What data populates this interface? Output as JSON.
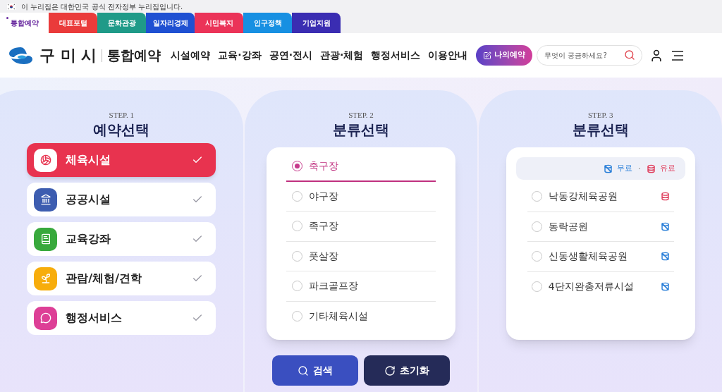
{
  "gov_banner": {
    "text": "이 누리집은 대한민국 공식 전자정부 누리집입니다."
  },
  "site_tabs": [
    {
      "label": "통합예약",
      "selected": true,
      "color": "#6a2ca0"
    },
    {
      "label": "대표포털",
      "selected": false,
      "color": "#ea3b3b"
    },
    {
      "label": "문화관광",
      "selected": false,
      "color": "#1f9a88"
    },
    {
      "label": "일자리경제",
      "selected": false,
      "color": "#1f50d2"
    },
    {
      "label": "시민복지",
      "selected": false,
      "color": "#eb3358"
    },
    {
      "label": "인구정책",
      "selected": false,
      "color": "#1790e2"
    },
    {
      "label": "기업지원",
      "selected": false,
      "color": "#3a2db2"
    }
  ],
  "header": {
    "logo_text": "구 미 시",
    "logo_subtitle": "통합예약",
    "nav": [
      "시설예약",
      "교육·강좌",
      "공연·전시",
      "관광·체험",
      "행정서비스",
      "이용안내"
    ],
    "my_reservation": "나의예약",
    "search_placeholder": "무엇이 궁금하세요?"
  },
  "steps": [
    {
      "kind": "category",
      "step_label": "STEP. 1",
      "title": "예약선택",
      "items": [
        {
          "label": "체육시설",
          "selected": true,
          "color": "#e8334f"
        },
        {
          "label": "공공시설",
          "selected": false,
          "color": "#3d5db0"
        },
        {
          "label": "교육강좌",
          "selected": false,
          "color": "#38a93c"
        },
        {
          "label": "관람/체험/견학",
          "selected": false,
          "color": "#f7ad0c"
        },
        {
          "label": "행정서비스",
          "selected": false,
          "color": "#dd3f96"
        }
      ]
    },
    {
      "kind": "radio",
      "step_label": "STEP. 2",
      "title": "분류선택",
      "items": [
        {
          "label": "축구장",
          "selected": true
        },
        {
          "label": "야구장",
          "selected": false
        },
        {
          "label": "족구장",
          "selected": false
        },
        {
          "label": "풋살장",
          "selected": false
        },
        {
          "label": "파크골프장",
          "selected": false
        },
        {
          "label": "기타체육시설",
          "selected": false
        }
      ]
    },
    {
      "kind": "facility",
      "step_label": "STEP. 3",
      "title": "분류선택",
      "legend": [
        {
          "kind": "free",
          "label": "무료"
        },
        {
          "kind": "paid",
          "label": "유료"
        }
      ],
      "items": [
        {
          "label": "낙동강체육공원",
          "selected": false,
          "kind": "paid"
        },
        {
          "label": "동락공원",
          "selected": false,
          "kind": "free"
        },
        {
          "label": "신동생활체육공원",
          "selected": false,
          "kind": "free"
        },
        {
          "label": "4단지완충저류시설",
          "selected": false,
          "kind": "free"
        }
      ]
    }
  ],
  "actions": [
    {
      "kind": "search",
      "label": "검색"
    },
    {
      "kind": "reset",
      "label": "초기화"
    }
  ]
}
